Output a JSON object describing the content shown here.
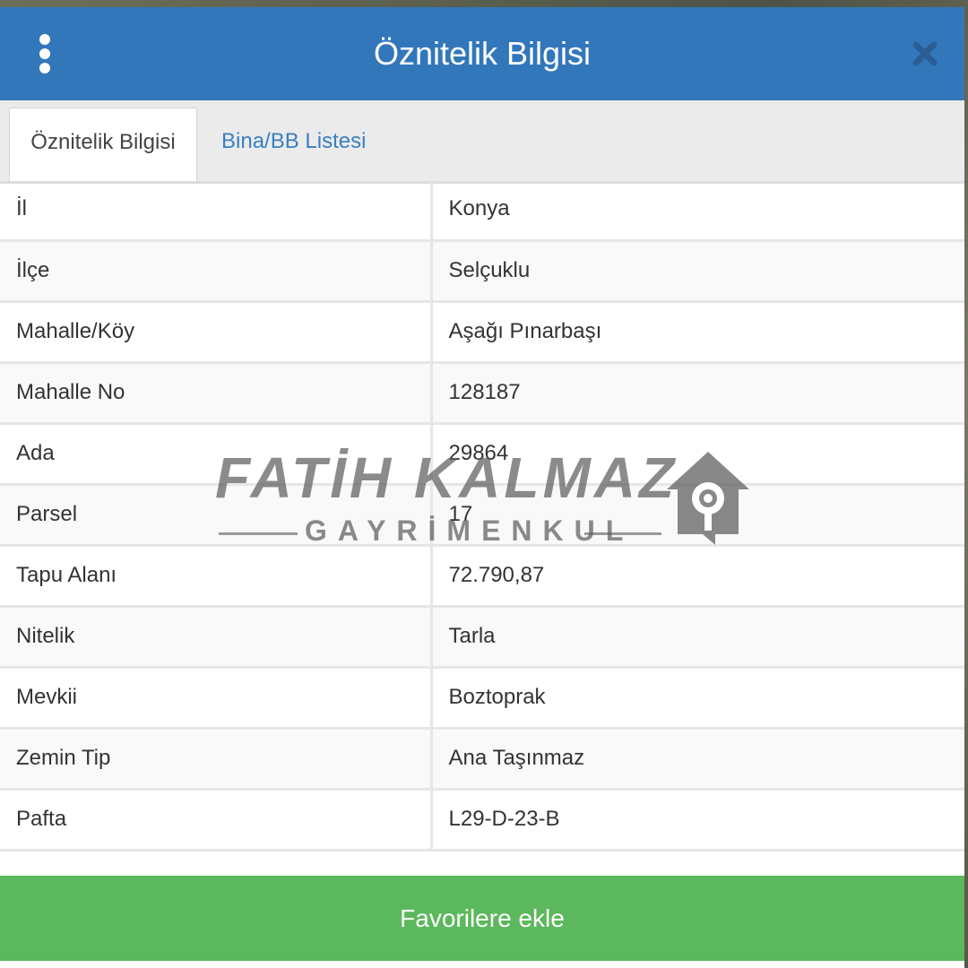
{
  "header": {
    "title": "Öznitelik Bilgisi"
  },
  "tabs": [
    {
      "label": "Öznitelik Bilgisi",
      "active": true
    },
    {
      "label": "Bina/BB Listesi",
      "active": false
    }
  ],
  "attributes": [
    {
      "key": "İl",
      "value": "Konya"
    },
    {
      "key": "İlçe",
      "value": "Selçuklu"
    },
    {
      "key": "Mahalle/Köy",
      "value": "Aşağı Pınarbaşı"
    },
    {
      "key": "Mahalle No",
      "value": "128187"
    },
    {
      "key": "Ada",
      "value": "29864"
    },
    {
      "key": "Parsel",
      "value": "17"
    },
    {
      "key": "Tapu Alanı",
      "value": "72.790,87"
    },
    {
      "key": "Nitelik",
      "value": "Tarla"
    },
    {
      "key": "Mevkii",
      "value": "Boztoprak"
    },
    {
      "key": "Zemin Tip",
      "value": "Ana Taşınmaz"
    },
    {
      "key": "Pafta",
      "value": "L29-D-23-B"
    }
  ],
  "footer": {
    "favorite_label": "Favorilere ekle"
  },
  "watermark": {
    "title": "FATİH KALMAZ",
    "subtitle": "GAYRİMENKUL"
  },
  "colors": {
    "header_bg": "#3377bb",
    "button_green": "#5cb85c",
    "tab_link": "#3a7fc4"
  }
}
